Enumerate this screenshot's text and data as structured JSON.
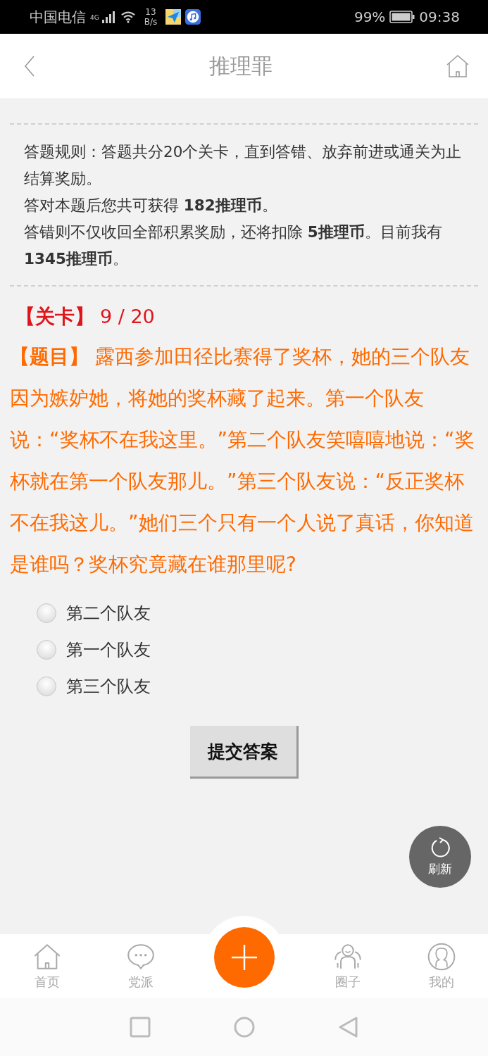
{
  "status_bar": {
    "carrier": "中国电信",
    "network": "4G",
    "speed_value": "13",
    "speed_unit": "B/s",
    "battery": "99%",
    "time": "09:38"
  },
  "header": {
    "title": "推理罪"
  },
  "rules": [
    "答题规则：答题共分20个关卡，直到答错、放弃前进或通关为止结算奖励。",
    "答对本题后您共可获得 **182推理币**。",
    "答错则不仅收回全部积累奖励，还将扣除 **5推理币**。目前我有 **1345推理币**。"
  ],
  "level": {
    "label": "【关卡】",
    "value": "9 / 20"
  },
  "question": "**【题目】** 露西参加田径比赛得了奖杯，她的三个队友因为嫉妒她，将她的奖杯藏了起来。第一个队友说：“奖杯不在我这里。”第二个队友笑嘻嘻地说：“奖杯就在第一个队友那儿。”第三个队友说：“反正奖杯不在我这儿。”她们三个只有一个人说了真话，你知道是谁吗？奖杯究竟藏在谁那里呢?",
  "options": [
    {
      "label": "第二个队友",
      "selected": false
    },
    {
      "label": "第一个队友",
      "selected": false
    },
    {
      "label": "第三个队友",
      "selected": false
    }
  ],
  "submit_button": "提交答案",
  "refresh_button": "刷新",
  "bottom_nav": [
    {
      "kind": "home",
      "label": "首页"
    },
    {
      "kind": "chat",
      "label": "党派"
    },
    {
      "kind": "add"
    },
    {
      "kind": "group",
      "label": "圈子"
    },
    {
      "kind": "user",
      "label": "我的"
    }
  ]
}
